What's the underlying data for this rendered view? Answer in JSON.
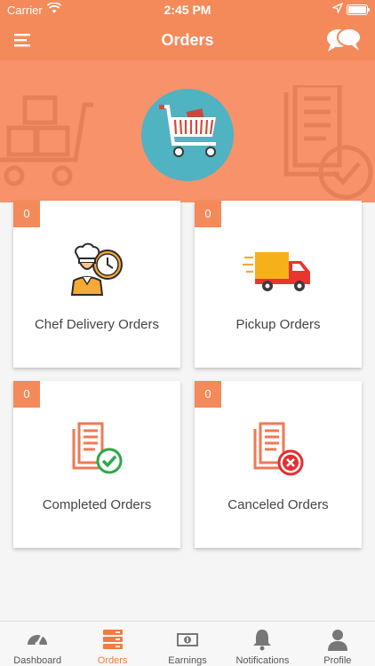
{
  "status_bar": {
    "carrier": "Carrier",
    "time": "2:45 PM"
  },
  "navbar": {
    "title": "Orders"
  },
  "cards": [
    {
      "count": "0",
      "label": "Chef Delivery Orders",
      "icon": "chef-clock-icon"
    },
    {
      "count": "0",
      "label": "Pickup Orders",
      "icon": "delivery-truck-icon"
    },
    {
      "count": "0",
      "label": "Completed Orders",
      "icon": "receipt-check-icon"
    },
    {
      "count": "0",
      "label": "Canceled Orders",
      "icon": "receipt-cancel-icon"
    }
  ],
  "tabs": [
    {
      "label": "Dashboard",
      "icon": "speedometer-icon"
    },
    {
      "label": "Orders",
      "icon": "orders-stack-icon",
      "active": true
    },
    {
      "label": "Earnings",
      "icon": "money-icon"
    },
    {
      "label": "Notifications",
      "icon": "bell-icon"
    },
    {
      "label": "Profile",
      "icon": "user-icon"
    }
  ],
  "colors": {
    "accent": "#f48a5a",
    "active_tab": "#f47a3e",
    "cart_circle": "#4fb3c2",
    "check": "#2ba84a",
    "cancel": "#e23030"
  }
}
